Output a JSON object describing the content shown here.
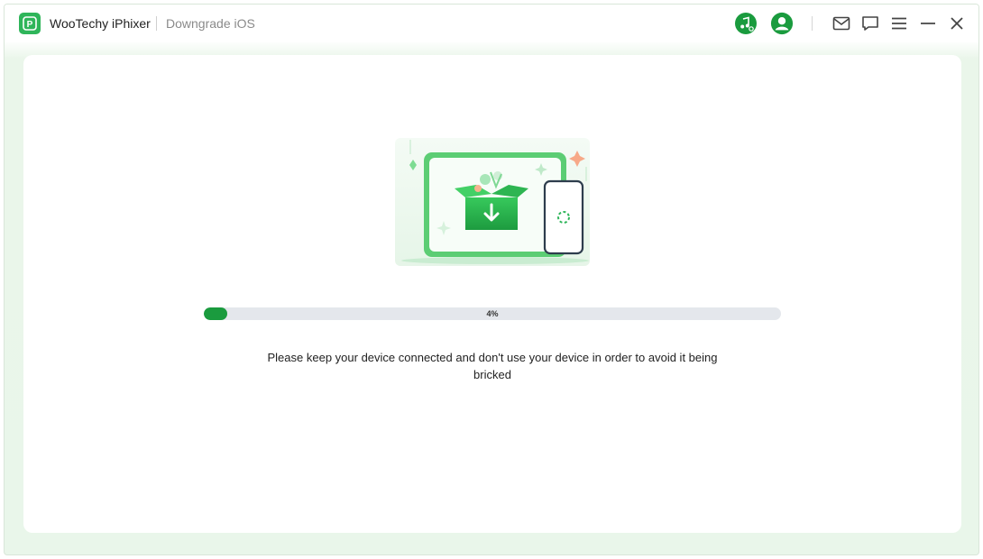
{
  "app": {
    "name": "WooTechy iPhixer",
    "module": "Downgrade iOS"
  },
  "toolbar": {
    "icons": [
      "music-search-icon",
      "account-icon",
      "mail-icon",
      "feedback-icon",
      "menu-icon",
      "minimize-icon",
      "close-icon"
    ]
  },
  "colors": {
    "accent": "#1a9b3e",
    "brand": "#2fb55a",
    "track": "#e4e7ec"
  },
  "progress": {
    "percent": 4,
    "label": "4%"
  },
  "message": "Please keep your device connected and don't use your device in order to avoid it being bricked"
}
